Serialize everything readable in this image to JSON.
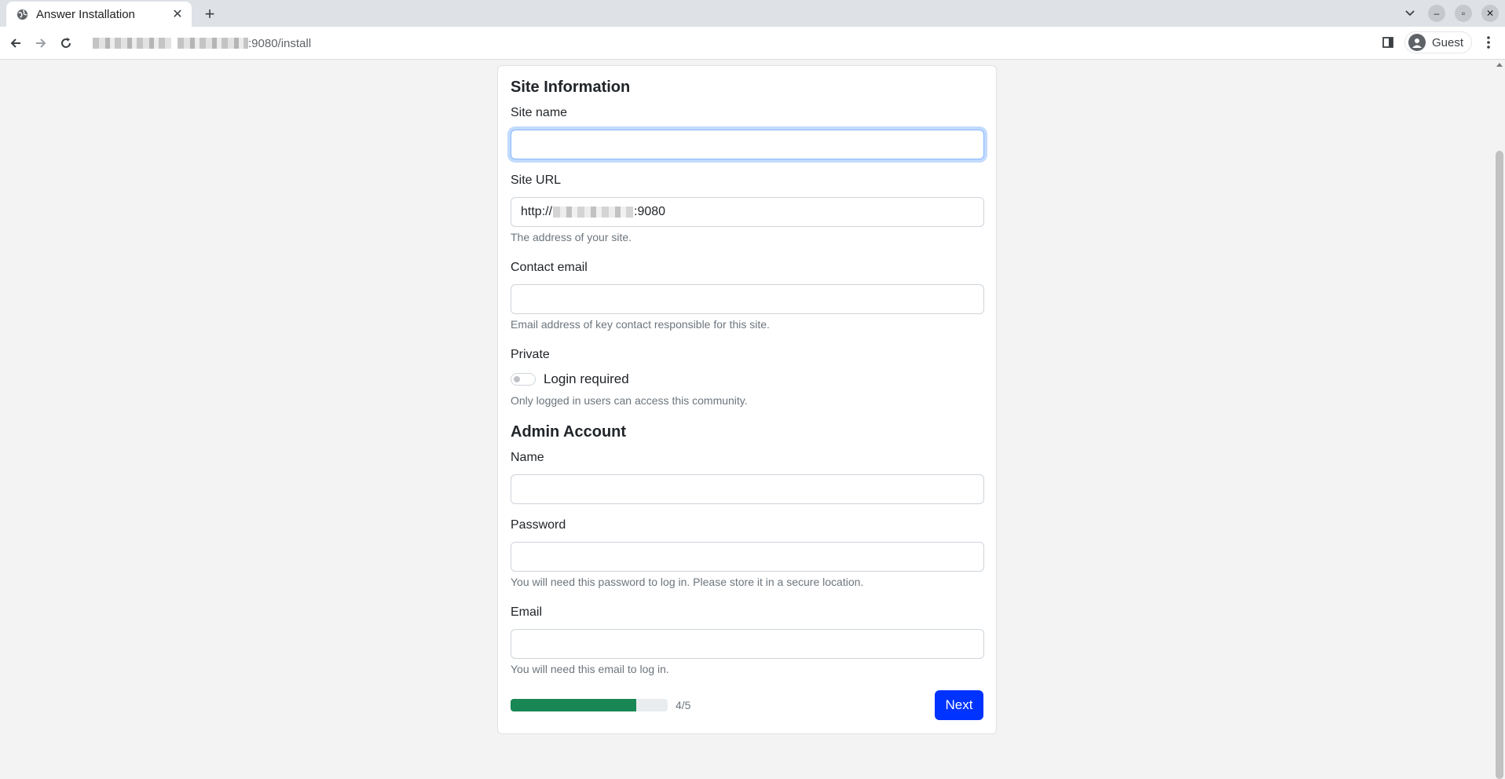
{
  "browser": {
    "tab_title": "Answer Installation",
    "url_suffix": ":9080/install",
    "profile_label": "Guest"
  },
  "form": {
    "site_info_title": "Site Information",
    "site_name_label": "Site name",
    "site_name_value": "",
    "site_url_label": "Site URL",
    "site_url_prefix": "http://",
    "site_url_suffix": ":9080",
    "site_url_help": "The address of your site.",
    "contact_email_label": "Contact email",
    "contact_email_value": "",
    "contact_email_help": "Email address of key contact responsible for this site.",
    "private_label": "Private",
    "login_required_label": "Login required",
    "login_required_checked": false,
    "private_help": "Only logged in users can access this community.",
    "admin_title": "Admin Account",
    "name_label": "Name",
    "password_label": "Password",
    "password_help": "You will need this password to log in. Please store it in a secure location.",
    "email_label": "Email",
    "email_help": "You will need this email to log in."
  },
  "progress": {
    "text": "4/5",
    "fraction": 0.8,
    "color": "#198754"
  },
  "next_button": {
    "label": "Next",
    "color": "#0033ff"
  }
}
